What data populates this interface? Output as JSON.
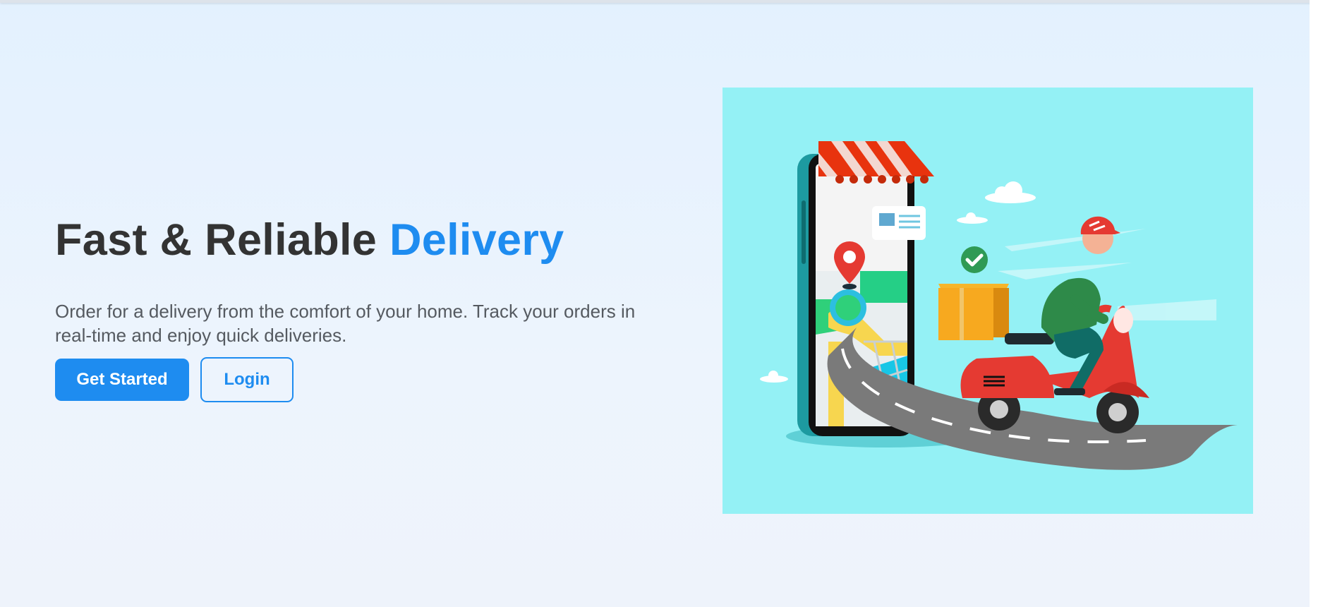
{
  "hero": {
    "headline_main": "Fast & Reliable ",
    "headline_accent": "Delivery",
    "description": "Order for a delivery from the comfort of your home. Track your orders in real-time and enjoy quick deliveries.",
    "primary_button_label": "Get Started",
    "secondary_button_label": "Login"
  },
  "illustration": {
    "icons": [
      "smartphone-icon",
      "shop-awning-icon",
      "map-pin-icon",
      "checkmark-icon",
      "package-icon",
      "scooter-icon",
      "delivery-rider-icon",
      "cloud-icon"
    ]
  },
  "colors": {
    "accent": "#1e8cf0",
    "headline": "#333333",
    "body_text": "#555a60",
    "illustration_bg": "#94f1f5",
    "scooter_red": "#e53a32"
  }
}
